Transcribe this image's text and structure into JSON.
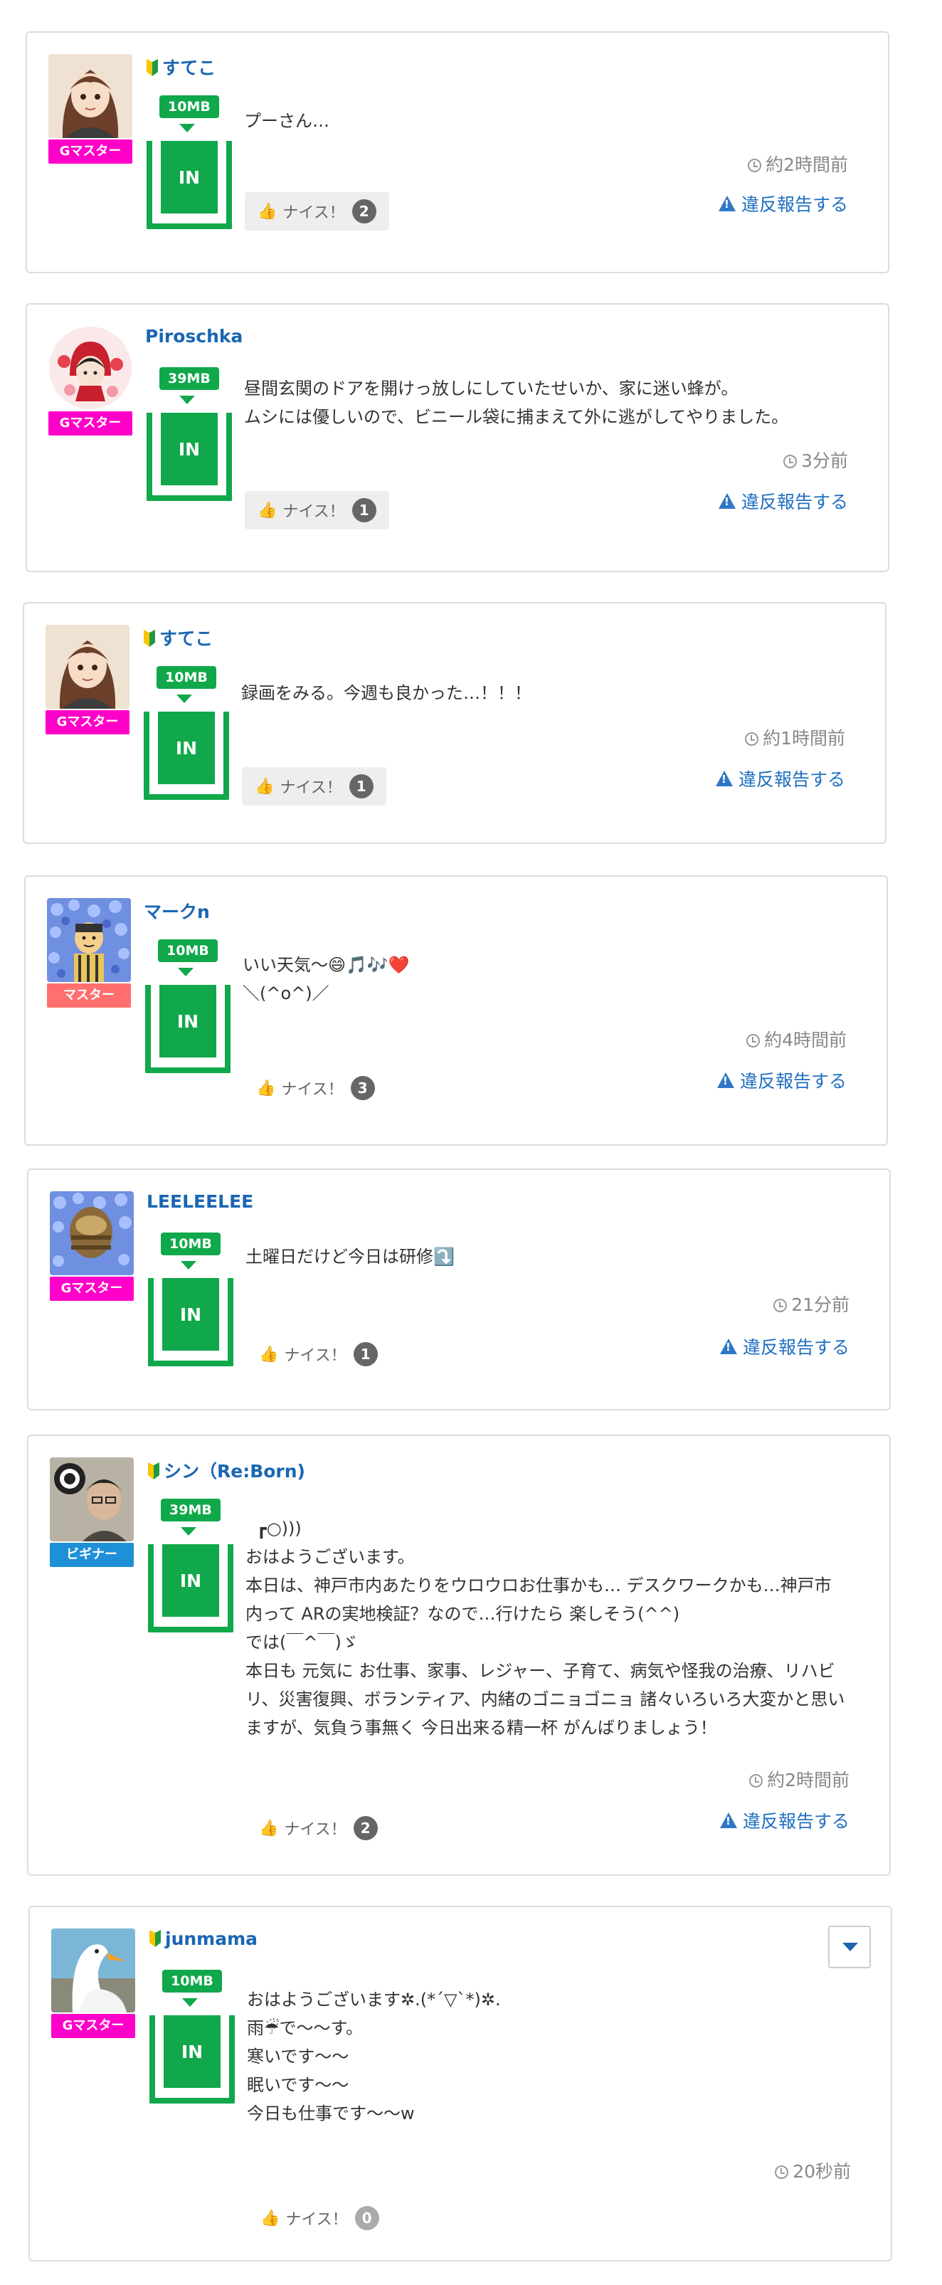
{
  "labels": {
    "nice": "ナイス！",
    "report": "違反報告する",
    "in": "IN"
  },
  "colors": {
    "accent_green": "#10a84a",
    "link_blue": "#1a66b3",
    "role_gmaster": "#ff00c8",
    "role_master": "#ff6f6f",
    "role_beginner": "#1e90d8"
  },
  "posts": [
    {
      "username": "すてこ",
      "beginner_mark": true,
      "role": "Gマスター",
      "data_size": "10MB",
      "message": "プーさん…",
      "time": "約2時間前",
      "nice_count": "2"
    },
    {
      "username": "Piroschka",
      "beginner_mark": false,
      "role": "Gマスター",
      "data_size": "39MB",
      "message": "昼間玄関のドアを開けっ放しにしていたせいか、家に迷い蜂が。\nムシには優しいので、ビニール袋に捕まえて外に逃がしてやりました。",
      "time": "3分前",
      "nice_count": "1"
    },
    {
      "username": "すてこ",
      "beginner_mark": true,
      "role": "Gマスター",
      "data_size": "10MB",
      "message": "録画をみる。今週も良かった…！！！",
      "time": "約1時間前",
      "nice_count": "1"
    },
    {
      "username": "マークn",
      "beginner_mark": false,
      "role": "マスター",
      "data_size": "10MB",
      "message": "いい天気〜😄🎵🎶❤️\n＼(^o^)／",
      "time": "約4時間前",
      "nice_count": "3"
    },
    {
      "username": "LEELEELEE",
      "beginner_mark": false,
      "role": "Gマスター",
      "data_size": "10MB",
      "message": "土曜日だけど今日は研修⤵️",
      "time": "21分前",
      "nice_count": "1"
    },
    {
      "username": "シン（Re:Born)",
      "beginner_mark": true,
      "role": "ビギナー",
      "data_size": "39MB",
      "message": "  ┏○)))\nおはようございます。\n本日は、神戸市内あたりをウロウロお仕事かも… デスクワークかも…神戸市内って ARの実地検証？なので…行けたら 楽しそう(^^)\nでは(￣^￣)ゞ\n本日も 元気に お仕事、家事、レジャー、子育て、病気や怪我の治療、リハビリ、災害復興、ボランティア、内緒のゴニョゴニョ 諸々いろいろ大変かと思いますが、気負う事無く 今日出来る精一杯 がんばりましょう！",
      "time": "約2時間前",
      "nice_count": "2"
    },
    {
      "username": "junmama",
      "beginner_mark": true,
      "role": "Gマスター",
      "data_size": "10MB",
      "message": "おはようございます✲.(*´▽`*)✲.\n雨☔で〜〜す。\n寒いです〜〜\n眠いです〜〜\n今日も仕事です〜〜w",
      "time": "20秒前",
      "nice_count": "0"
    }
  ]
}
